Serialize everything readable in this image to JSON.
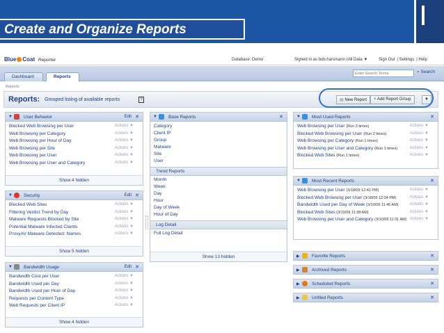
{
  "slide": {
    "title": "Create and Organize Reports"
  },
  "app": {
    "logo": "Blue",
    "logo2": "Coat",
    "product": "Reporter",
    "database": "Database: Demo",
    "signed_in": "Signed in as bob.harsmann (All Data  ▼",
    "top_links": [
      "Sign Out",
      "Settings",
      "Help"
    ],
    "tabs": [
      "Dashboard",
      "Reports"
    ],
    "search_placeholder": "Enter Search Terms",
    "search_button": "Search",
    "breadcrumb": "Reports",
    "page_title": "Reports:",
    "page_subtitle": "Grouped listing of available reports",
    "help_glyph": "?",
    "new_report": "New Report",
    "add_report_group": "Add Report Group",
    "actions_label": "Actions  ▼"
  },
  "panels": {
    "user_behavior": {
      "title": "User Behavior",
      "edit": "Edit",
      "items": [
        "Blocked Web Browsing per User",
        "Web Browsing per Category",
        "Web Browsing per Hour of Day",
        "Web Browsing per Site",
        "Web Browsing per User",
        "Web Browsing per User and Category"
      ],
      "hidden": "Show 4 hidden"
    },
    "security": {
      "title": "Security",
      "edit": "Edit",
      "items": [
        "Blocked Web Sites",
        "Filtering Verdict Trend by Day",
        "Malware Requests Blocked by Site",
        "Potential Malware Infected Clients",
        "ProxyAV Malware Detected: Names"
      ],
      "hidden": "Show 5 hidden"
    },
    "bandwidth": {
      "title": "Bandwidth Usage",
      "edit": "Edit",
      "items": [
        "Bandwidth Cost per User",
        "Bandwidth Used per Day",
        "Bandwidth Used per Hour of Day",
        "Requests per Content Type",
        "Web Requests per Client IP"
      ],
      "hidden": "Show 4 hidden"
    },
    "base_reports": {
      "title": "Base Reports",
      "items": [
        "Category",
        "Client IP",
        "Group",
        "Malware",
        "Site",
        "User"
      ],
      "trend_title": "Trend Reports",
      "trend_items": [
        "Month",
        "Week",
        "Day",
        "Hour",
        "Day of Week",
        "Hour of Day"
      ],
      "log_title": "Log Detail",
      "log_items": [
        "Full Log Detail"
      ],
      "hidden": "Show 13 hidden"
    },
    "most_used": {
      "title": "Most Used Reports",
      "items": [
        {
          "name": "Web Browsing per User",
          "sub": "(Run 3 times)"
        },
        {
          "name": "Blocked Web Browsing per User",
          "sub": "(Run 2 times)"
        },
        {
          "name": "Web Browsing per Category",
          "sub": "(Run 1 times)"
        },
        {
          "name": "Web Browsing per User and Category",
          "sub": "(Run 1 times)"
        },
        {
          "name": "Blocked Web Sites",
          "sub": "(Run 1 times)"
        }
      ]
    },
    "most_recent": {
      "title": "Most Recent Reports",
      "items": [
        {
          "name": "Web Browsing per User",
          "sub": "(3/18/09 12:42 PM)"
        },
        {
          "name": "Blocked Web Browsing per User",
          "sub": "(3/18/09 12:24 PM)"
        },
        {
          "name": "Bandwidth Used per Day of Week",
          "sub": "(3/10/09 11:46 AM)"
        },
        {
          "name": "Blocked Web Sites",
          "sub": "(3/10/09 11:38 AM)"
        },
        {
          "name": "Web Browsing per User and Category",
          "sub": "(3/10/09 11:31 AM)"
        }
      ]
    },
    "collapsed": [
      "Favorite Reports",
      "Archived Reports",
      "Scheduled Reports",
      "Unfiled Reports"
    ]
  }
}
